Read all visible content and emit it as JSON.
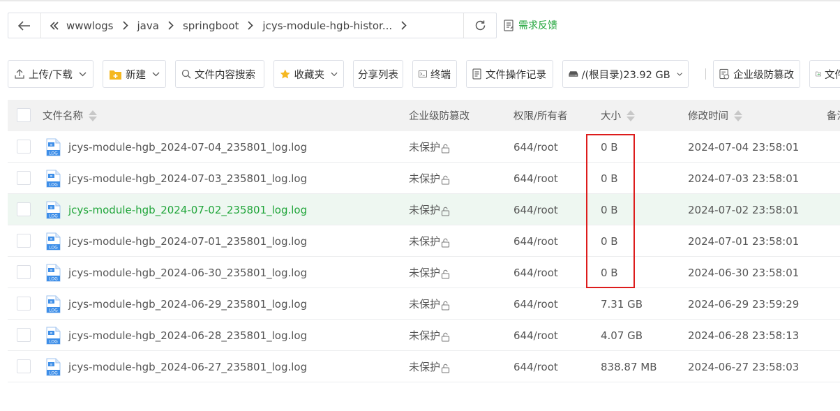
{
  "addressbar": {
    "crumbs": [
      "wwwlogs",
      "java",
      "springboot",
      "jcys-module-hgb-histor..."
    ]
  },
  "feedback": {
    "label": "需求反馈"
  },
  "toolbar": {
    "upload_download": "上传/下载",
    "new": "新建",
    "content_search": "文件内容搜索",
    "favorites": "收藏夹",
    "share_list": "分享列表",
    "terminal": "终端",
    "op_log": "文件操作记录",
    "disk": "/(根目录)23.92 GB",
    "tamper": "企业级防篡改",
    "more": "文件"
  },
  "table": {
    "headers": {
      "name": "文件名称",
      "protect": "企业级防篡改",
      "perm": "权限/所有者",
      "size": "大小",
      "mtime": "修改时间",
      "remark": "备注"
    },
    "rows": [
      {
        "name": "jcys-module-hgb_2024-07-04_235801_log.log",
        "protect": "未保护",
        "perm": "644/root",
        "size": "0 B",
        "mtime": "2024-07-04 23:58:01"
      },
      {
        "name": "jcys-module-hgb_2024-07-03_235801_log.log",
        "protect": "未保护",
        "perm": "644/root",
        "size": "0 B",
        "mtime": "2024-07-03 23:58:01"
      },
      {
        "name": "jcys-module-hgb_2024-07-02_235801_log.log",
        "protect": "未保护",
        "perm": "644/root",
        "size": "0 B",
        "mtime": "2024-07-02 23:58:01"
      },
      {
        "name": "jcys-module-hgb_2024-07-01_235801_log.log",
        "protect": "未保护",
        "perm": "644/root",
        "size": "0 B",
        "mtime": "2024-07-01 23:58:01"
      },
      {
        "name": "jcys-module-hgb_2024-06-30_235801_log.log",
        "protect": "未保护",
        "perm": "644/root",
        "size": "0 B",
        "mtime": "2024-06-30 23:58:01"
      },
      {
        "name": "jcys-module-hgb_2024-06-29_235801_log.log",
        "protect": "未保护",
        "perm": "644/root",
        "size": "7.31 GB",
        "mtime": "2024-06-29 23:59:29"
      },
      {
        "name": "jcys-module-hgb_2024-06-28_235801_log.log",
        "protect": "未保护",
        "perm": "644/root",
        "size": "4.07 GB",
        "mtime": "2024-06-28 23:58:13"
      },
      {
        "name": "jcys-module-hgb_2024-06-27_235801_log.log",
        "protect": "未保护",
        "perm": "644/root",
        "size": "838.87 MB",
        "mtime": "2024-06-27 23:58:03"
      }
    ],
    "file_icon_text": {
      "top": "≡",
      "bottom": "LOG"
    }
  },
  "colors": {
    "accent_green": "#20a53a",
    "highlight_red": "#dd1c1c",
    "file_icon_blue": "#3d8ee8",
    "hover_row": "#eef7f1"
  }
}
